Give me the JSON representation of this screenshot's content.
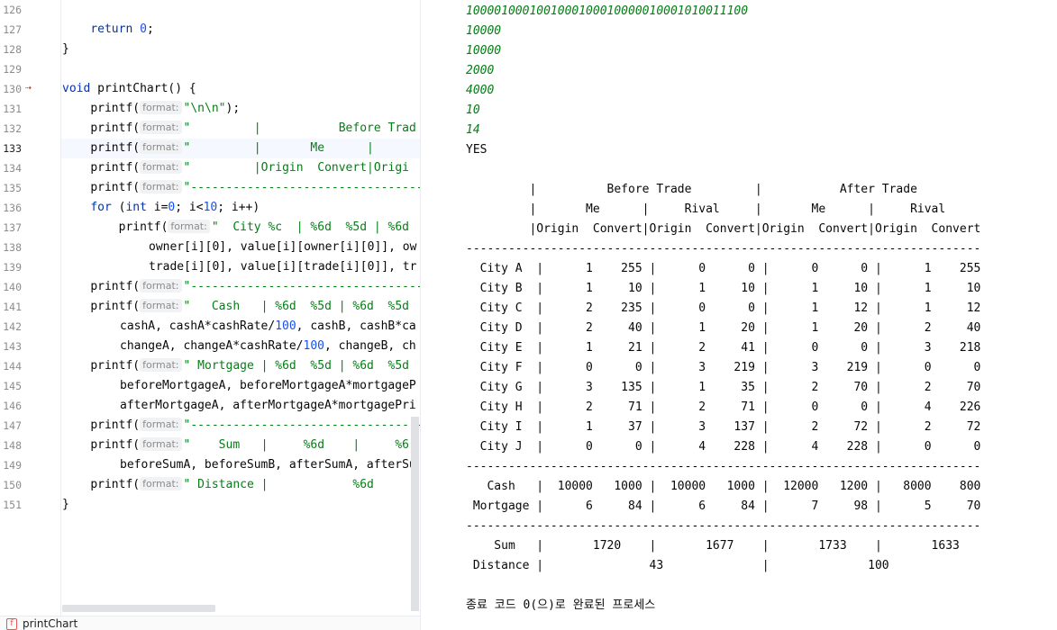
{
  "editor": {
    "current_line": 133,
    "line_numbers": [
      "126",
      "127",
      "128",
      "129",
      "130",
      "131",
      "132",
      "133",
      "134",
      "135",
      "136",
      "137",
      "138",
      "139",
      "140",
      "141",
      "142",
      "143",
      "144",
      "145",
      "146",
      "147",
      "148",
      "149",
      "150",
      "151"
    ],
    "param_hint": "format:",
    "code": {
      "l127": [
        "return",
        "0",
        ";"
      ],
      "l128": "}",
      "l130": [
        "void",
        " printChart() {"
      ],
      "l131": [
        "printf(",
        "\"\\n\\n\"",
        ");"
      ],
      "l132": [
        "printf(",
        "\"         |           Before Trad"
      ],
      "l133": [
        "printf(",
        "\"         |       Me      |"
      ],
      "l134": [
        "printf(",
        "\"         |Origin  Convert|Origi"
      ],
      "l135": [
        "printf(",
        "\"---------------------------------"
      ],
      "l136": [
        "for",
        " (",
        "int",
        " i=",
        "0",
        "; i<",
        "10",
        "; i++)"
      ],
      "l137": [
        "printf(",
        "\"  City %c  | %6d  %5d | %6d"
      ],
      "l138": "owner[i][0], value[i][owner[i][0]], ow",
      "l139": "trade[i][0], value[i][trade[i][0]], tr",
      "l140": [
        "printf(",
        "\"---------------------------------"
      ],
      "l141": [
        "printf(",
        "\"   Cash   | %6d  %5d | %6d  %5d"
      ],
      "l142": [
        "cashA, cashA*cashRate/",
        "100",
        ", cashB, cashB*ca"
      ],
      "l143": [
        "changeA, changeA*cashRate/",
        "100",
        ", changeB, ch"
      ],
      "l144": [
        "printf(",
        "\" Mortgage | %6d  %5d | %6d  %5d"
      ],
      "l145": "beforeMortgageA, beforeMortgageA*mortgageP",
      "l146": "afterMortgageA, afterMortgageA*mortgagePri",
      "l147": [
        "printf(",
        "\"---------------------------------"
      ],
      "l148": [
        "printf(",
        "\"    Sum   |     %6d    |     %6"
      ],
      "l149": "beforeSumA, beforeSumB, afterSumA, afterSu",
      "l150": [
        "printf(",
        "\" Distance |            %6d"
      ],
      "l151": "}"
    }
  },
  "status": {
    "function_name": "printChart"
  },
  "console": {
    "lines": [
      "1000010001001000100010000010001010011100",
      "10000",
      "10000",
      "2000",
      "4000",
      "10",
      "14",
      "YES",
      "",
      "         |          Before Trade         |           After Trade",
      "         |       Me      |     Rival     |       Me      |     Rival",
      "         |Origin  Convert|Origin  Convert|Origin  Convert|Origin  Convert",
      "-------------------------------------------------------------------------",
      "  City A  |      1    255 |      0      0 |      0      0 |      1    255",
      "  City B  |      1     10 |      1     10 |      1     10 |      1     10",
      "  City C  |      2    235 |      0      0 |      1     12 |      1     12",
      "  City D  |      2     40 |      1     20 |      1     20 |      2     40",
      "  City E  |      1     21 |      2     41 |      0      0 |      3    218",
      "  City F  |      0      0 |      3    219 |      3    219 |      0      0",
      "  City G  |      3    135 |      1     35 |      2     70 |      2     70",
      "  City H  |      2     71 |      2     71 |      0      0 |      4    226",
      "  City I  |      1     37 |      3    137 |      2     72 |      2     72",
      "  City J  |      0      0 |      4    228 |      4    228 |      0      0",
      "-------------------------------------------------------------------------",
      "   Cash   |  10000   1000 |  10000   1000 |  12000   1200 |   8000    800",
      " Mortgage |      6     84 |      6     84 |      7     98 |      5     70",
      "-------------------------------------------------------------------------",
      "    Sum   |       1720    |       1677    |       1733    |       1633",
      " Distance |               43              |              100",
      "",
      "종료 코드 0(으)로 완료된 프로세스"
    ]
  }
}
